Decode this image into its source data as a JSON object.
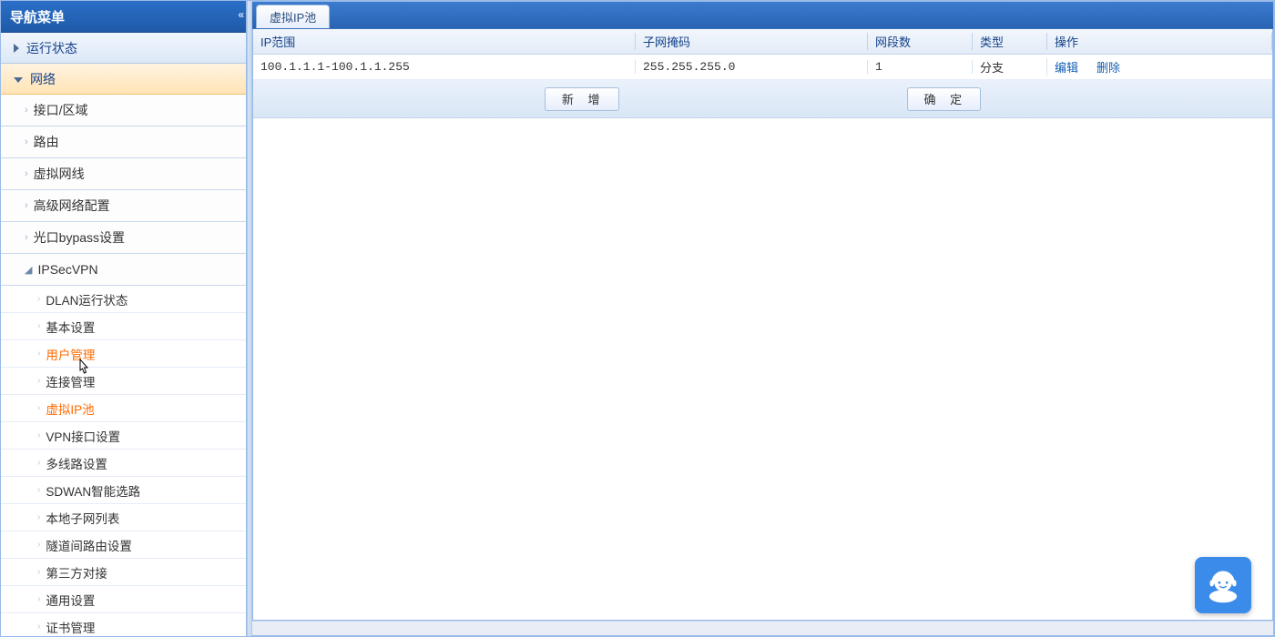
{
  "sidebar": {
    "title": "导航菜单",
    "sections": [
      {
        "label": "运行状态",
        "expanded": false
      },
      {
        "label": "网络",
        "expanded": true,
        "items": [
          {
            "label": "接口/区域"
          },
          {
            "label": "路由"
          },
          {
            "label": "虚拟网线"
          },
          {
            "label": "高级网络配置"
          },
          {
            "label": "光口bypass设置"
          },
          {
            "label": "IPSecVPN",
            "expanded": true,
            "children": [
              {
                "label": "DLAN运行状态"
              },
              {
                "label": "基本设置"
              },
              {
                "label": "用户管理",
                "highlight": true
              },
              {
                "label": "连接管理"
              },
              {
                "label": "虚拟IP池",
                "highlight": true
              },
              {
                "label": "VPN接口设置"
              },
              {
                "label": "多线路设置"
              },
              {
                "label": "SDWAN智能选路"
              },
              {
                "label": "本地子网列表"
              },
              {
                "label": "隧道间路由设置"
              },
              {
                "label": "第三方对接"
              },
              {
                "label": "通用设置"
              },
              {
                "label": "证书管理"
              }
            ]
          }
        ]
      }
    ]
  },
  "main": {
    "tab_label": "虚拟IP池",
    "columns": {
      "ip_range": "IP范围",
      "mask": "子网掩码",
      "segments": "网段数",
      "type": "类型",
      "actions": "操作"
    },
    "rows": [
      {
        "ip_range": "100.1.1.1-100.1.1.255",
        "mask": "255.255.255.0",
        "segments": "1",
        "type": "分支",
        "edit": "编辑",
        "delete": "删除"
      }
    ],
    "buttons": {
      "add": "新 增",
      "confirm": "确 定"
    }
  }
}
